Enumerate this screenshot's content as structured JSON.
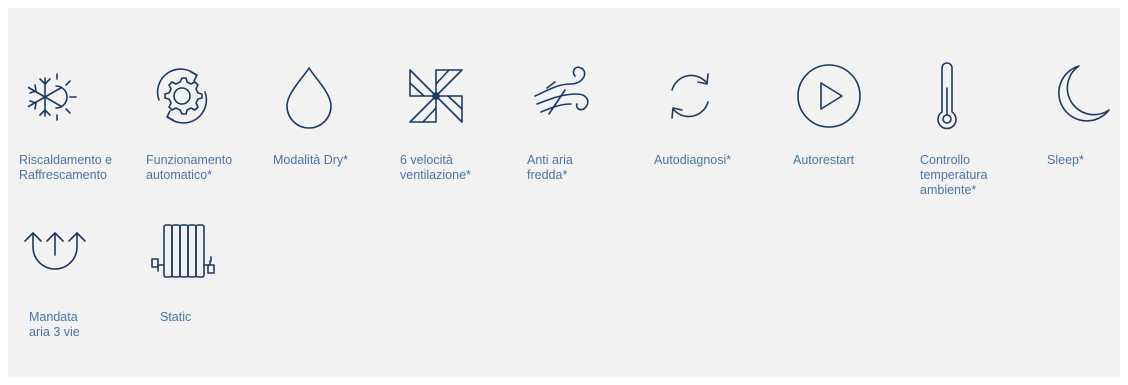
{
  "features": [
    {
      "label": "Riscaldamento e\nRaffrescamento",
      "icon": "snowflake-sun-icon"
    },
    {
      "label": "Funzionamento\nautomatico*",
      "icon": "auto-gear-icon"
    },
    {
      "label": "Modalità Dry*",
      "icon": "water-drop-icon"
    },
    {
      "label": "6 velocità\nventilazione*",
      "icon": "pinwheel-fan-icon"
    },
    {
      "label": "Anti aria\nfredda*",
      "icon": "wind-icon"
    },
    {
      "label": "Autodiagnosi*",
      "icon": "refresh-arrows-icon"
    },
    {
      "label": "Autorestart",
      "icon": "play-circle-icon"
    },
    {
      "label": "Controllo\ntemperatura\nambiente*",
      "icon": "thermometer-icon"
    },
    {
      "label": "Sleep*",
      "icon": "moon-icon"
    },
    {
      "label": "Mandata\naria 3 vie",
      "icon": "three-way-airflow-icon"
    },
    {
      "label": "Static",
      "icon": "radiator-icon"
    }
  ],
  "colors": {
    "panel_bg": "#f2f2f2",
    "icon_stroke": "#1b3a63",
    "label_text": "#4a75a5"
  }
}
